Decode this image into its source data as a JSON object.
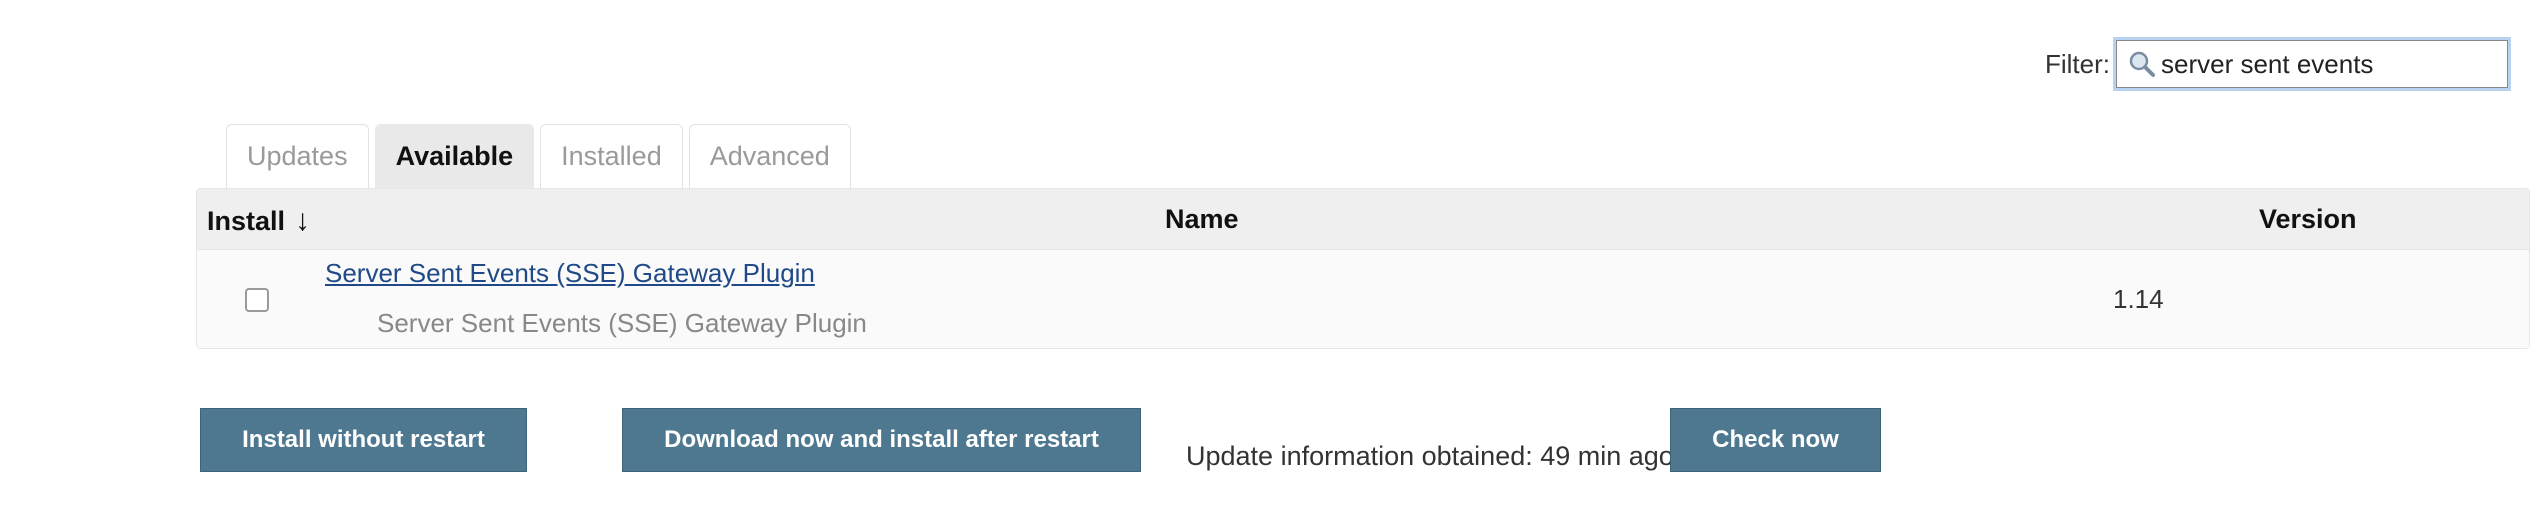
{
  "filter": {
    "label": "Filter:",
    "value": "server sent events",
    "icon": "magnifier-icon"
  },
  "tabs": [
    {
      "label": "Updates",
      "active": false
    },
    {
      "label": "Available",
      "active": true
    },
    {
      "label": "Installed",
      "active": false
    },
    {
      "label": "Advanced",
      "active": false
    }
  ],
  "table": {
    "headers": {
      "install": "Install",
      "sort_indicator": "↓",
      "name": "Name",
      "version": "Version"
    },
    "rows": [
      {
        "checked": false,
        "name": "Server Sent Events (SSE) Gateway Plugin",
        "description": "Server Sent Events (SSE) Gateway Plugin",
        "version": "1.14"
      }
    ]
  },
  "actions": {
    "install_without_restart": "Install without restart",
    "download_and_install": "Download now and install after restart",
    "update_info": "Update information obtained: 49 min ago",
    "check_now": "Check now"
  },
  "colors": {
    "button_bg": "#4e7890",
    "link": "#204a87",
    "active_tab_bg": "#e9e9e9"
  }
}
